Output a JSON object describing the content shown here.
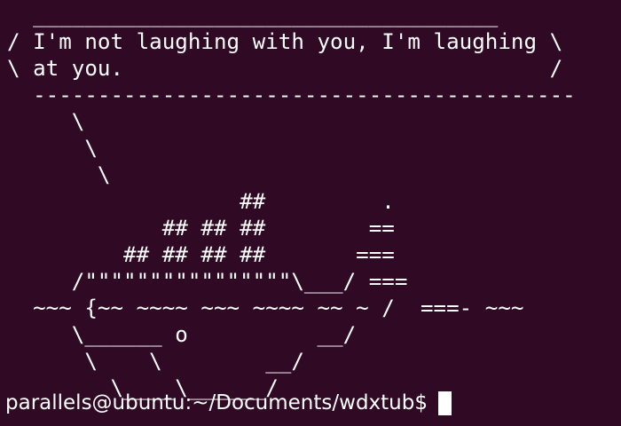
{
  "terminal": {
    "output_text": "  ____________________________________\n/ I'm not laughing with you, I'm laughing \\\n\\ at you.                                 /\n  ------------------------------------------\n     \\\n      \\\n       \\\n                  ##         .\n            ## ## ##        ==\n         ## ## ## ##       ===\n     /\"\"\"\"\"\"\"\"\"\"\"\"\"\"\"\"\\___/ ===\n  ~~~ {~~ ~~~~ ~~~ ~~~~ ~~ ~ /  ===- ~~~\n     \\______ o          __/\n      \\    \\        __/\n        \\____\\______/",
    "prompt": "parallels@ubuntu:~/Documents/wdxtub$",
    "colors": {
      "background": "#300a24",
      "foreground": "#ffffff"
    }
  }
}
